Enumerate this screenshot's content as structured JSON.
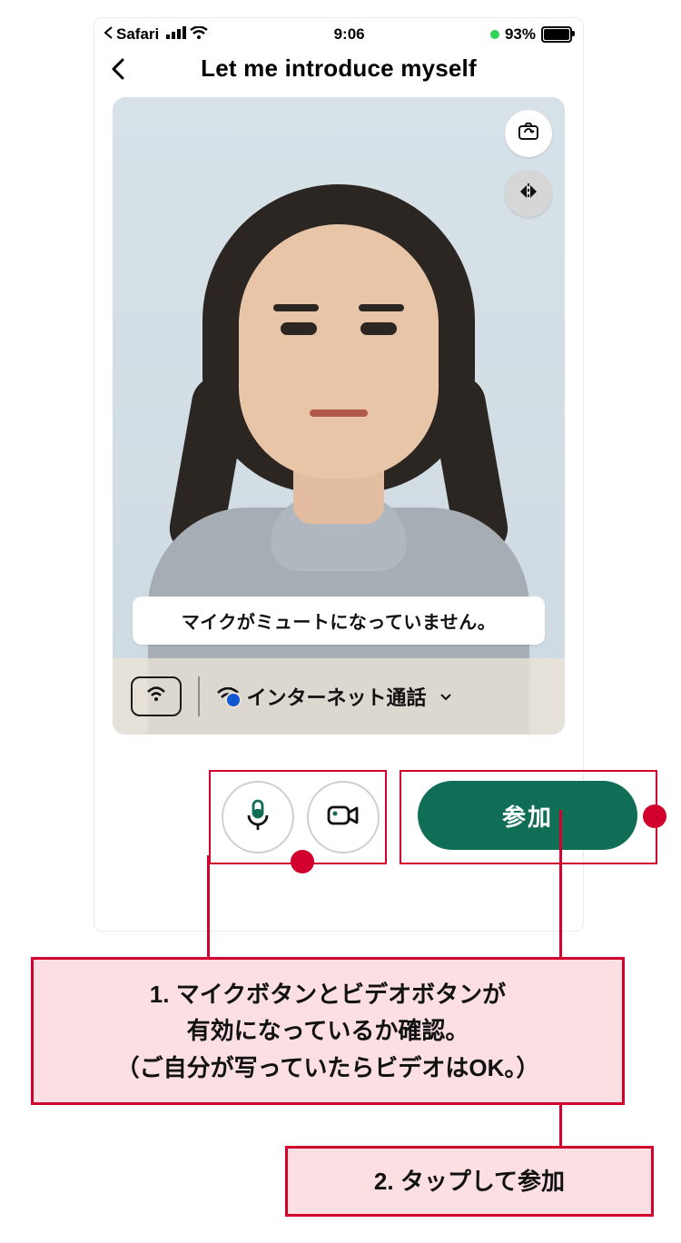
{
  "statusbar": {
    "back_app": "Safari",
    "time": "9:06",
    "battery_pct": "93%"
  },
  "header": {
    "title": "Let me introduce myself"
  },
  "video": {
    "toast": "マイクがミュートになっていません。",
    "audio_option": "インターネット通話"
  },
  "controls": {
    "join_label": "参加"
  },
  "annotations": {
    "note1_line1": "1. マイクボタンとビデオボタンが",
    "note1_line2": "有効になっているか確認。",
    "note1_line3": "（ご自分が写っていたらビデオはOK。）",
    "note2": "2. タップして参加"
  }
}
